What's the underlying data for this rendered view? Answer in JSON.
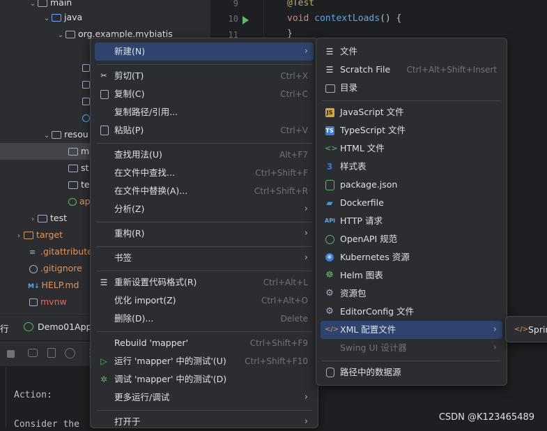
{
  "project_tree": {
    "items": [
      {
        "label": "main"
      },
      {
        "label": "java"
      },
      {
        "label": "org.example.mybiatis"
      },
      {
        "label": "resou"
      },
      {
        "label": "m"
      },
      {
        "label": "st"
      },
      {
        "label": "te"
      },
      {
        "label": "ap"
      },
      {
        "label": "test"
      },
      {
        "label": "target"
      },
      {
        "label": ".gitattribute"
      },
      {
        "label": ".gitignore"
      },
      {
        "label": "HELP.md"
      },
      {
        "label": "mvnw"
      }
    ],
    "md_badge": "M↓"
  },
  "editor": {
    "line_numbers": [
      "9",
      "10",
      "11"
    ],
    "annotation": "@Test",
    "keyword_void": "void",
    "method_name": "contextLoads",
    "method_rest": "() {",
    "closing_brace": "}"
  },
  "run_panel": {
    "tab_prefix": "行",
    "run_config": "Demo01App",
    "console_lines": [
      "Action:",
      "Consider the"
    ]
  },
  "context_menu": {
    "new": {
      "label": "新建(N)"
    },
    "cut": {
      "label": "剪切(T)",
      "shortcut": "Ctrl+X"
    },
    "copy": {
      "label": "复制(C)",
      "shortcut": "Ctrl+C"
    },
    "copy_path": {
      "label": "复制路径/引用..."
    },
    "paste": {
      "label": "粘贴(P)",
      "shortcut": "Ctrl+V"
    },
    "find_usages": {
      "label": "查找用法(U)",
      "shortcut": "Alt+F7"
    },
    "find_in_files": {
      "label": "在文件中查找...",
      "shortcut": "Ctrl+Shift+F"
    },
    "replace_in_files": {
      "label": "在文件中替换(A)...",
      "shortcut": "Ctrl+Shift+R"
    },
    "analyze": {
      "label": "分析(Z)"
    },
    "refactor": {
      "label": "重构(R)"
    },
    "bookmarks": {
      "label": "书签"
    },
    "reformat": {
      "label": "重新设置代码格式(R)",
      "shortcut": "Ctrl+Alt+L"
    },
    "optimize_imports": {
      "label": "优化 import(Z)",
      "shortcut": "Ctrl+Alt+O"
    },
    "delete": {
      "label": "删除(D)...",
      "shortcut": "Delete"
    },
    "rebuild": {
      "label": "Rebuild 'mapper'",
      "shortcut": "Ctrl+Shift+F9"
    },
    "run_tests": {
      "label": "运行 'mapper' 中的测试'(U)",
      "shortcut": "Ctrl+Shift+F10"
    },
    "debug_tests": {
      "label": "调试 'mapper' 中的测试'(D)"
    },
    "more_run": {
      "label": "更多运行/调试"
    },
    "open_in": {
      "label": "打开于"
    }
  },
  "new_submenu": {
    "file": {
      "label": "文件"
    },
    "scratch": {
      "label": "Scratch File",
      "shortcut": "Ctrl+Alt+Shift+Insert"
    },
    "directory": {
      "label": "目录"
    },
    "js": {
      "label": "JavaScript 文件",
      "badge": "JS"
    },
    "ts": {
      "label": "TypeScript 文件",
      "badge": "TS"
    },
    "html": {
      "label": "HTML 文件"
    },
    "css": {
      "label": "样式表"
    },
    "package_json": {
      "label": "package.json"
    },
    "dockerfile": {
      "label": "Dockerfile"
    },
    "http": {
      "label": "HTTP 请求",
      "badge": "API"
    },
    "openapi": {
      "label": "OpenAPI 规范"
    },
    "kubernetes": {
      "label": "Kubernetes 资源"
    },
    "helm": {
      "label": "Helm 图表"
    },
    "resource_bundle": {
      "label": "资源包"
    },
    "editorconfig": {
      "label": "EditorConfig 文件"
    },
    "xml_config": {
      "label": "XML 配置文件"
    },
    "swing": {
      "label": "Swing UI 设计器"
    },
    "datasource": {
      "label": "路径中的数据源"
    }
  },
  "xml_submenu": {
    "spring": {
      "label": "Sprin"
    }
  },
  "watermark": "CSDN @K123465489",
  "colors": {
    "highlight": "#2e436e",
    "menu_bg": "#2b2d30",
    "editor_bg": "#1e1f22",
    "accent_orange": "#e0955b",
    "run_green": "#5fb865"
  }
}
